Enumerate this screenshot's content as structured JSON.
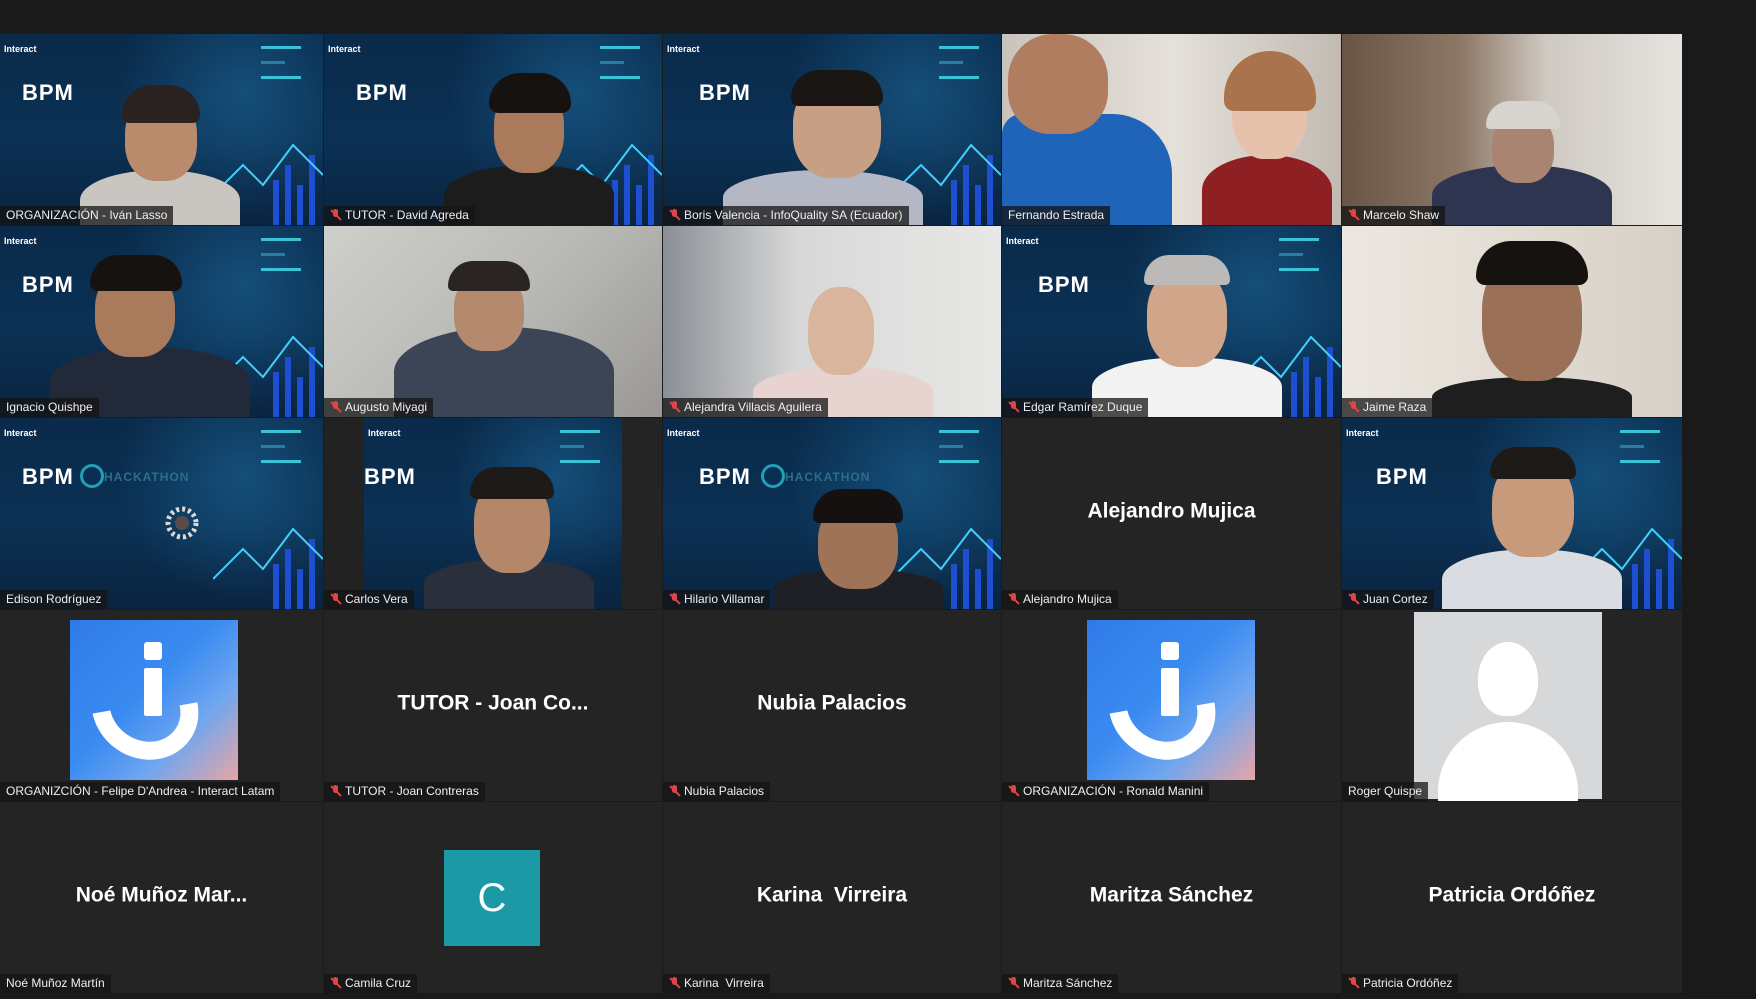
{
  "background_label": {
    "brand": "Interact",
    "bpm": "BPM",
    "hackathon": "HACKATHON"
  },
  "participants": [
    {
      "tag": "ORGANIZACIÓN - Iván Lasso",
      "muted": false
    },
    {
      "tag": "TUTOR - David Agreda",
      "muted": true
    },
    {
      "tag": "Boris Valencia - InfoQuality SA (Ecuador)",
      "muted": true
    },
    {
      "tag": "Fernando Estrada",
      "muted": false,
      "speaking": true
    },
    {
      "tag": "Marcelo Shaw",
      "muted": true
    },
    {
      "tag": "Ignacio Quishpe",
      "muted": false
    },
    {
      "tag": "Augusto Miyagi",
      "muted": true
    },
    {
      "tag": "Alejandra Villacis Aguilera",
      "muted": true
    },
    {
      "tag": "Edgar Ramírez Duque",
      "muted": true
    },
    {
      "tag": "Jaime Raza",
      "muted": true
    },
    {
      "tag": "Edison Rodríguez",
      "muted": false
    },
    {
      "tag": "Carlos Vera",
      "muted": true
    },
    {
      "tag": "Hilario Villamar",
      "muted": true
    },
    {
      "tag": "Alejandro Mujica",
      "muted": true,
      "display_name": "Alejandro Mujica"
    },
    {
      "tag": "Juan Cortez",
      "muted": true
    },
    {
      "tag": "ORGANIZCIÓN - Felipe D'Andrea - Interact Latam",
      "muted": false
    },
    {
      "tag": "TUTOR - Joan Contreras",
      "muted": true,
      "display_name": "TUTOR - Joan Co..."
    },
    {
      "tag": "Nubia Palacios",
      "muted": true,
      "display_name": "Nubia Palacios"
    },
    {
      "tag": "ORGANIZACIÓN - Ronald Manini",
      "muted": true
    },
    {
      "tag": "Roger Quispe",
      "muted": false
    },
    {
      "tag": "Noé Muñoz Martín",
      "muted": false,
      "display_name": "Noé Muñoz Mar..."
    },
    {
      "tag": "Camila Cruz",
      "muted": true,
      "avatar_letter": "C"
    },
    {
      "tag": "Karina  Virreira",
      "muted": true,
      "display_name": "Karina  Virreira"
    },
    {
      "tag": "Maritza Sánchez",
      "muted": true,
      "display_name": "Maritza Sánchez"
    },
    {
      "tag": "Patricia Ordóñez",
      "muted": true,
      "display_name": "Patricia Ordóñez"
    }
  ],
  "colors": {
    "speaking_border": "#d5e36a",
    "muted_icon": "#e04545",
    "avatar_c": "#1b9aa6"
  }
}
